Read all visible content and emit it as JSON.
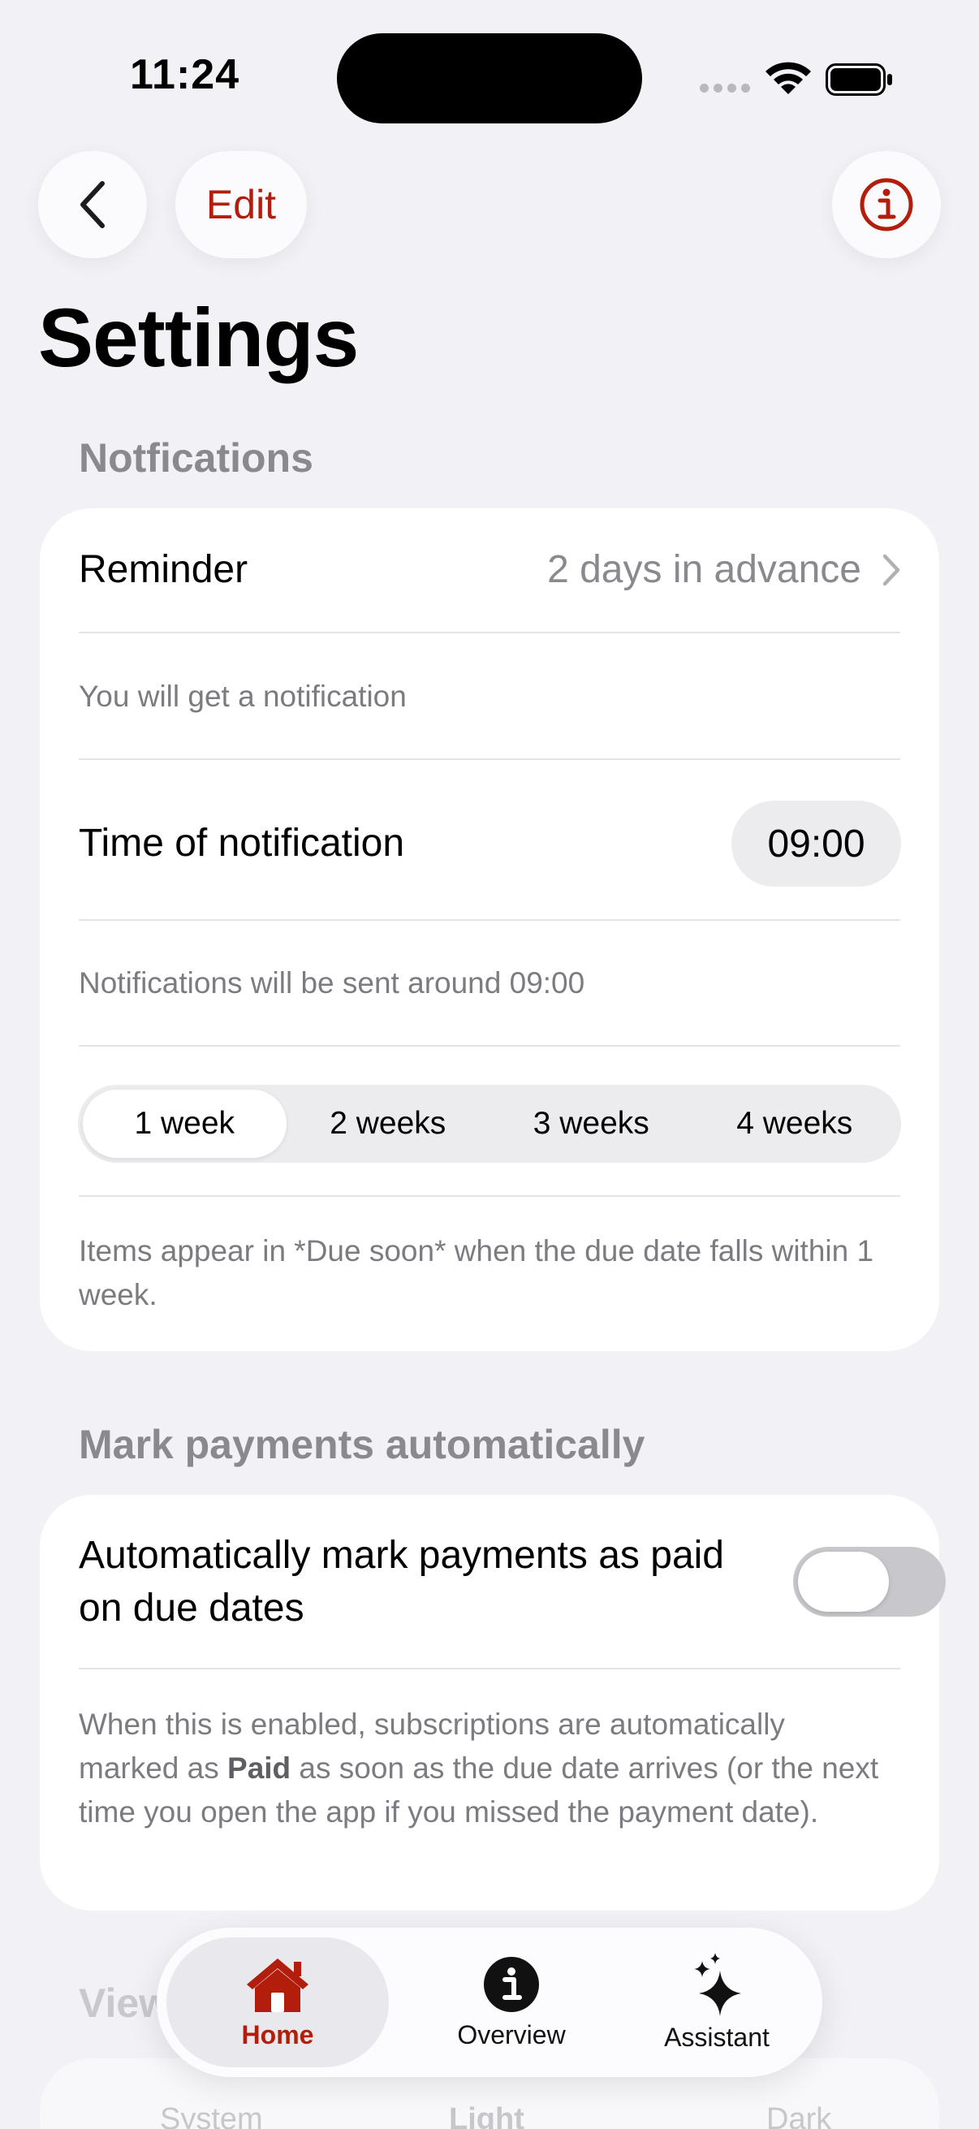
{
  "status_bar": {
    "time": "11:24"
  },
  "nav": {
    "edit_label": "Edit"
  },
  "page_title": "Settings",
  "notifications": {
    "header": "Notfications",
    "reminder_label": "Reminder",
    "reminder_value": "2 days in advance",
    "reminder_note": "You will get a notification",
    "time_label": "Time of notification",
    "time_value": "09:00",
    "time_note": "Notifications will be sent around 09:00",
    "due_soon_options": [
      "1 week",
      "2 weeks",
      "3 weeks",
      "4 weeks"
    ],
    "due_soon_selected": "1 week",
    "due_soon_note": "Items appear in *Due soon* when the due date falls within 1 week."
  },
  "auto_mark": {
    "header": "Mark payments automatically",
    "toggle_label": "Automatically mark payments as paid on due dates",
    "toggle_on": false,
    "note_before": "When this is enabled, subscriptions are automatically marked as ",
    "note_bold": "Paid",
    "note_after": " as soon as the due date arrives (or the next time you open the app if you missed the payment date)."
  },
  "view": {
    "header_partial": "View",
    "options": [
      "System",
      "Light",
      "Dark"
    ]
  },
  "tabbar": {
    "items": [
      {
        "label": "Home",
        "icon": "house-icon",
        "active": true
      },
      {
        "label": "Overview",
        "icon": "info-circle-icon",
        "active": false
      },
      {
        "label": "Assistant",
        "icon": "sparkles-icon",
        "active": false
      }
    ]
  },
  "colors": {
    "accent": "#b31d0b",
    "background": "#f2f1f6",
    "secondary_text": "#8a898f"
  }
}
